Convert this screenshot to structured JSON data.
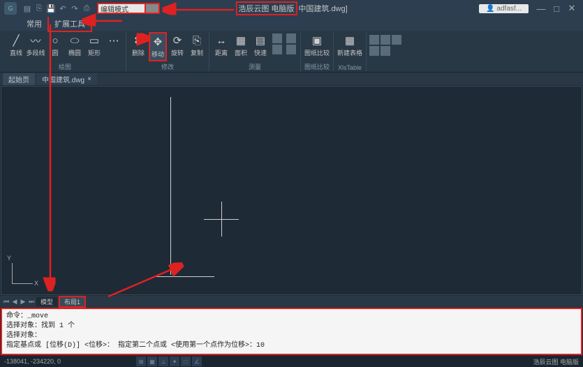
{
  "title": {
    "app": "浩辰云图 电脑版",
    "doc": "中国建筑.dwg]"
  },
  "user": "adfasf...",
  "search": {
    "label": "编辑模式"
  },
  "menu": {
    "common": "常用",
    "ext_tools": "扩展工具"
  },
  "ribbon": {
    "line": "直线",
    "polyline": "多段线",
    "circle": "圆",
    "ellipse": "椭圆",
    "rect": "矩形",
    "delete": "删除",
    "move": "移动",
    "rotate": "旋转",
    "copy": "复制",
    "dist": "距离",
    "area": "面积",
    "quick": "快速",
    "compare": "图纸比较",
    "newtable": "新建表格",
    "g_draw": "绘图",
    "g_mod": "修改",
    "g_meas": "测量",
    "g_cmp": "图纸比较",
    "g_tbl": "XlsTable"
  },
  "doctabs": {
    "start": "起始页",
    "active": "中国建筑.dwg"
  },
  "ucs": {
    "x": "X",
    "y": "Y"
  },
  "layout": {
    "model": "模型",
    "layout1": "布局1"
  },
  "cmd": {
    "l1": "命令：_move",
    "l2": "选择对象：找到 1 个",
    "l3": "选择对象：",
    "l4": "指定基点或 [位移(D)] <位移>：  指定第二个点或 <使用第一个点作为位移>：10"
  },
  "status": {
    "coord": "-138041, -234220, 0",
    "right": "浩辰云图 电脑版"
  }
}
